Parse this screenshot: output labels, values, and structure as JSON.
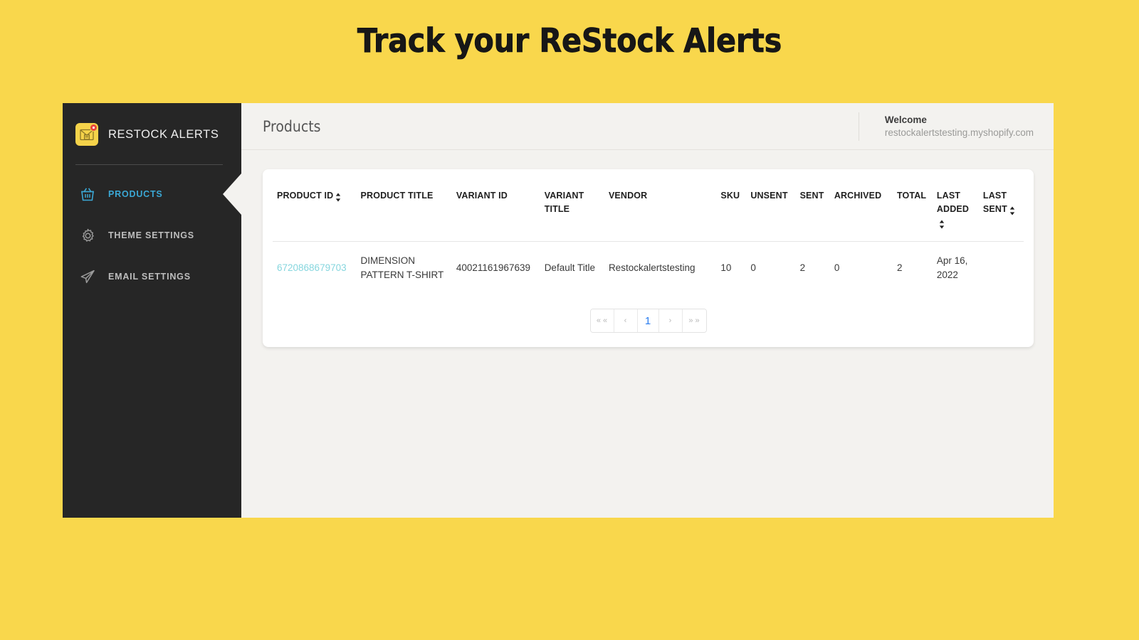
{
  "banner": {
    "title": "Track your ReStock Alerts"
  },
  "sidebar": {
    "brand_name": "RESTOCK ALERTS",
    "brand_icon": "mail-alert-icon",
    "items": [
      {
        "label": "PRODUCTS",
        "icon": "basket-icon",
        "active": true
      },
      {
        "label": "THEME SETTINGS",
        "icon": "gear-icon",
        "active": false
      },
      {
        "label": "EMAIL SETTINGS",
        "icon": "paper-plane-icon",
        "active": false
      }
    ]
  },
  "topbar": {
    "title": "Products",
    "welcome_label": "Welcome",
    "shop_domain": "restockalertstesting.myshopify.com"
  },
  "table": {
    "columns": [
      {
        "label": "PRODUCT ID",
        "sortable": true
      },
      {
        "label": "PRODUCT TITLE",
        "sortable": false
      },
      {
        "label": "VARIANT ID",
        "sortable": false
      },
      {
        "label": "VARIANT TITLE",
        "sortable": false
      },
      {
        "label": "VENDOR",
        "sortable": false
      },
      {
        "label": "SKU",
        "sortable": false
      },
      {
        "label": "UNSENT",
        "sortable": false
      },
      {
        "label": "SENT",
        "sortable": false
      },
      {
        "label": "ARCHIVED",
        "sortable": false
      },
      {
        "label": "TOTAL",
        "sortable": false
      },
      {
        "label": "LAST ADDED",
        "sortable": true
      },
      {
        "label": "LAST SENT",
        "sortable": true
      }
    ],
    "rows": [
      {
        "product_id": "6720868679703",
        "product_title": "DIMENSION PATTERN T-SHIRT",
        "variant_id": "40021161967639",
        "variant_title": "Default Title",
        "vendor": "Restockalertstesting",
        "sku": "10",
        "unsent": "0",
        "sent": "2",
        "archived": "0",
        "total": "2",
        "last_added": "Apr 16, 2022",
        "last_sent": ""
      }
    ]
  },
  "pagination": {
    "first": "« «",
    "prev": "‹",
    "current": "1",
    "next": "›",
    "last": "» »"
  },
  "colors": {
    "page_background": "#f9d74c",
    "sidebar": "#262626",
    "app_background": "#f3f2ef",
    "card": "#ffffff",
    "accent_active": "#3ba7d4",
    "link": "#86d6de",
    "pager_active": "#2a7df0",
    "brand_logo": "#f5d34a",
    "badge": "#e8453c"
  }
}
